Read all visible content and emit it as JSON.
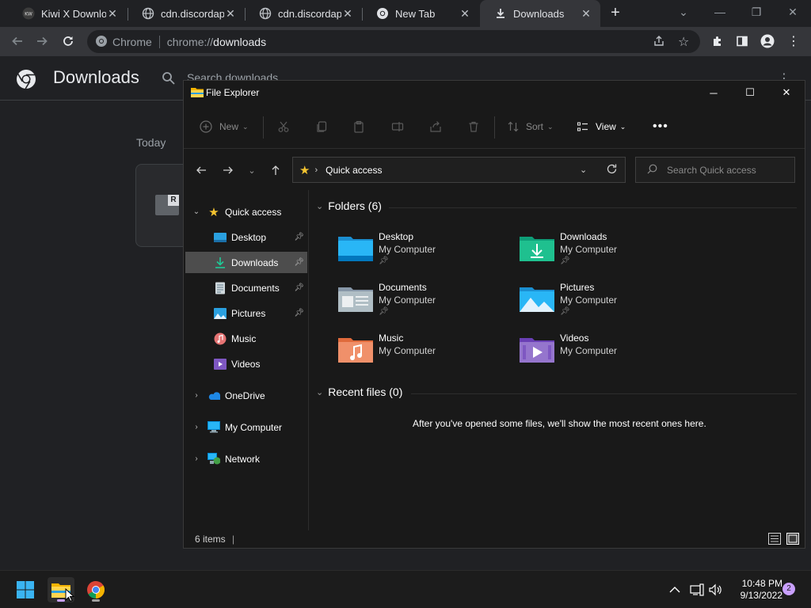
{
  "browser": {
    "tabs": [
      {
        "title": "Kiwi X Downloa",
        "favicon": "kiwi-icon"
      },
      {
        "title": "cdn.discordapp",
        "favicon": "globe-icon"
      },
      {
        "title": "cdn.discordapp",
        "favicon": "globe-icon"
      },
      {
        "title": "New Tab",
        "favicon": "chrome-icon"
      },
      {
        "title": "Downloads",
        "favicon": "download-icon"
      }
    ],
    "omnibox": {
      "scheme_label": "Chrome",
      "url_prefix": "chrome://",
      "url_host": "downloads"
    }
  },
  "downloads_page": {
    "title": "Downloads",
    "search_placeholder": "Search downloads",
    "date_group": "Today",
    "card_icon_letter": "R"
  },
  "explorer": {
    "title": "File Explorer",
    "commands": {
      "new": "New",
      "sort": "Sort",
      "view": "View"
    },
    "address": "Quick access",
    "search_placeholder": "Search Quick access",
    "nav": {
      "quick_access": "Quick access",
      "pinned": [
        {
          "label": "Desktop",
          "icon": "desktop-folder-icon",
          "pinned": true
        },
        {
          "label": "Downloads",
          "icon": "downloads-folder-icon",
          "pinned": true
        },
        {
          "label": "Documents",
          "icon": "documents-folder-icon",
          "pinned": true
        },
        {
          "label": "Pictures",
          "icon": "pictures-folder-icon",
          "pinned": true
        },
        {
          "label": "Music",
          "icon": "music-folder-icon",
          "pinned": false
        },
        {
          "label": "Videos",
          "icon": "videos-folder-icon",
          "pinned": false
        }
      ],
      "onedrive": "OneDrive",
      "my_computer": "My Computer",
      "network": "Network"
    },
    "folders_header": "Folders (6)",
    "folders": [
      {
        "name": "Desktop",
        "location": "My Computer",
        "pinned": true
      },
      {
        "name": "Downloads",
        "location": "My Computer",
        "pinned": true
      },
      {
        "name": "Documents",
        "location": "My Computer",
        "pinned": true
      },
      {
        "name": "Pictures",
        "location": "My Computer",
        "pinned": true
      },
      {
        "name": "Music",
        "location": "My Computer",
        "pinned": false
      },
      {
        "name": "Videos",
        "location": "My Computer",
        "pinned": false
      }
    ],
    "recent_header": "Recent files (0)",
    "recent_empty": "After you've opened some files, we'll show the most recent ones here.",
    "status": "6 items"
  },
  "taskbar": {
    "time": "10:48 PM",
    "date": "9/13/2022",
    "notifications": "2"
  }
}
